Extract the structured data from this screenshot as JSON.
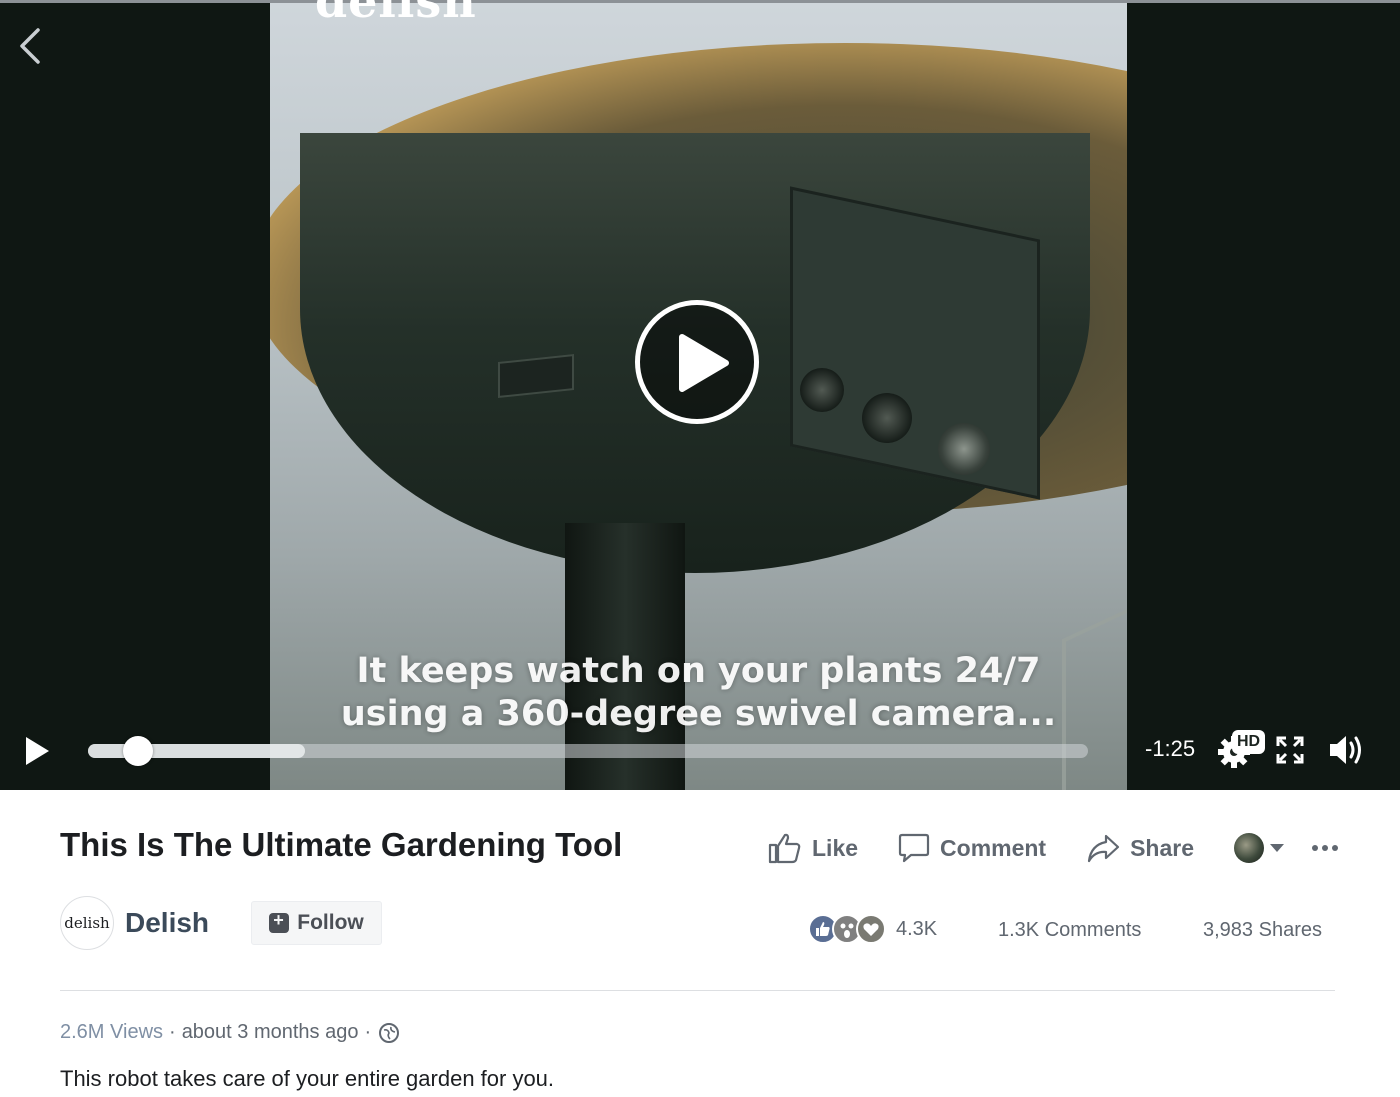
{
  "video": {
    "watermark": "delish",
    "caption_line1": "It keeps watch on your plants 24/7",
    "caption_line2": "using a 360-degree swivel camera...",
    "time_remaining": "-1:25",
    "hd_label": "HD",
    "progress_fraction": 0.05,
    "buffered_fraction": 0.217,
    "icons": [
      "back-arrow-icon",
      "play-icon",
      "settings-gear-icon",
      "fullscreen-icon",
      "volume-icon"
    ]
  },
  "post": {
    "title": "This Is The Ultimate Gardening Tool",
    "actions": {
      "like": "Like",
      "comment": "Comment",
      "share": "Share"
    },
    "page": {
      "avatar_text": "delish",
      "name": "Delish",
      "follow_label": "Follow"
    },
    "stats": {
      "reactions": "4.3K",
      "comments": "1.3K Comments",
      "shares": "3,983 Shares"
    },
    "meta": {
      "views": "2.6M Views",
      "time": "about 3 months ago",
      "separator": "·"
    },
    "description": "This robot takes care of your entire garden for you."
  },
  "colors": {
    "player_bg": "#0f1713",
    "text_primary": "#1c1e21",
    "text_secondary": "#606770",
    "link": "#385898"
  }
}
